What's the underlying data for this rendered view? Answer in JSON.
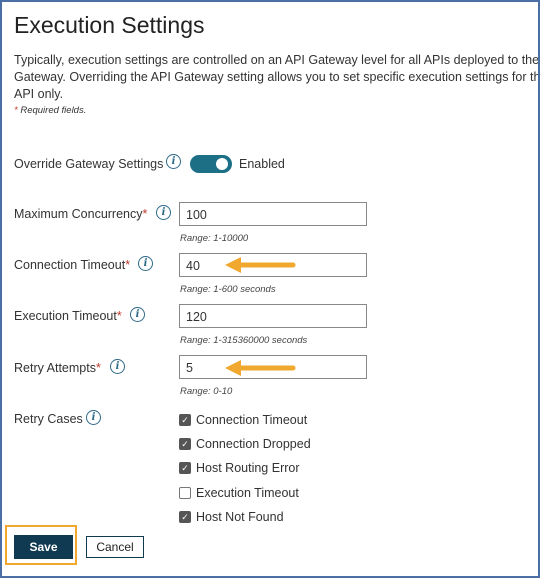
{
  "page": {
    "title": "Execution Settings",
    "description_lines": [
      "Typically, execution settings are controlled on an API Gateway level for all APIs deployed to the A",
      "Gateway. Overriding the API Gateway setting allows you to set specific execution settings for this",
      "API only."
    ],
    "required_note": "Required fields."
  },
  "override": {
    "label": "Override Gateway Settings",
    "state_text": "Enabled",
    "enabled": true
  },
  "fields": {
    "max_concurrency": {
      "label": "Maximum Concurrency",
      "value": "100",
      "hint": "Range: 1-10000"
    },
    "connection_timeout": {
      "label": "Connection Timeout",
      "value": "40",
      "hint": "Range: 1-600 seconds"
    },
    "execution_timeout": {
      "label": "Execution Timeout",
      "value": "120",
      "hint": "Range: 1-315360000 seconds"
    },
    "retry_attempts": {
      "label": "Retry Attempts",
      "value": "5",
      "hint": "Range: 0-10"
    }
  },
  "retry_cases": {
    "label": "Retry Cases",
    "options": [
      {
        "label": "Connection Timeout",
        "checked": true
      },
      {
        "label": "Connection Dropped",
        "checked": true
      },
      {
        "label": "Host Routing Error",
        "checked": true
      },
      {
        "label": "Execution Timeout",
        "checked": false
      },
      {
        "label": "Host Not Found",
        "checked": true
      }
    ]
  },
  "buttons": {
    "save": "Save",
    "cancel": "Cancel"
  },
  "colors": {
    "toggle_on": "#1c6f85",
    "save_button": "#0f3a52",
    "highlight_arrow": "#f0a92e",
    "required_star": "#c0392b",
    "info_icon": "#2e6a88"
  },
  "icons": {
    "info": "info-icon",
    "arrow": "arrow-left-icon",
    "checkbox_checked": "checkbox-checked-icon"
  }
}
